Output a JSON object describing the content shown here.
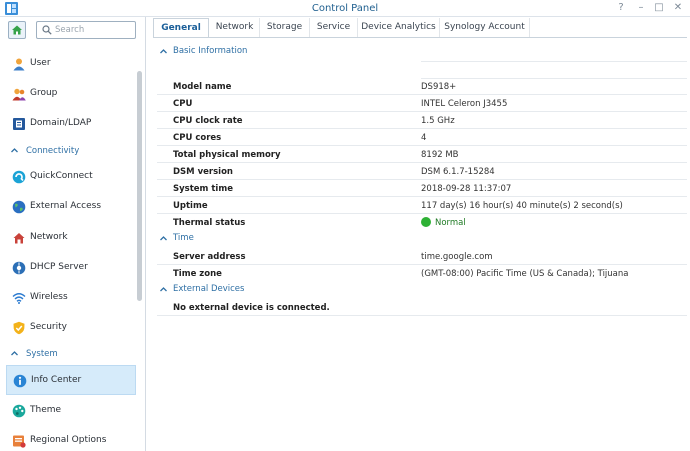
{
  "window": {
    "title": "Control Panel",
    "controls": [
      "help-icon",
      "minimize-icon",
      "maximize-icon",
      "close-icon"
    ]
  },
  "sidebar": {
    "search_placeholder": "Search",
    "items": [
      {
        "label": "User",
        "icon": "user-icon"
      },
      {
        "label": "Group",
        "icon": "group-icon"
      },
      {
        "label": "Domain/LDAP",
        "icon": "domain-icon"
      },
      {
        "label": "QuickConnect",
        "icon": "quickconnect-icon"
      },
      {
        "label": "External Access",
        "icon": "globe-icon"
      },
      {
        "label": "Network",
        "icon": "network-icon"
      },
      {
        "label": "DHCP Server",
        "icon": "dhcp-icon"
      },
      {
        "label": "Wireless",
        "icon": "wifi-icon"
      },
      {
        "label": "Security",
        "icon": "shield-icon"
      },
      {
        "label": "Info Center",
        "icon": "info-icon",
        "active": true
      },
      {
        "label": "Theme",
        "icon": "palette-icon"
      },
      {
        "label": "Regional Options",
        "icon": "regional-icon"
      }
    ],
    "sections": [
      "Connectivity",
      "System"
    ]
  },
  "tabs": [
    "General",
    "Network",
    "Storage",
    "Service",
    "Device Analytics",
    "Synology Account"
  ],
  "groups": {
    "basic": {
      "title": "Basic Information",
      "rows": [
        {
          "key": "Model name",
          "value": "DS918+"
        },
        {
          "key": "CPU",
          "value": "INTEL Celeron J3455"
        },
        {
          "key": "CPU clock rate",
          "value": "1.5 GHz"
        },
        {
          "key": "CPU cores",
          "value": "4"
        },
        {
          "key": "Total physical memory",
          "value": "8192 MB"
        },
        {
          "key": "DSM version",
          "value": "DSM 6.1.7-15284"
        },
        {
          "key": "System time",
          "value": "2018-09-28 11:37:07"
        },
        {
          "key": "Uptime",
          "value": "117 day(s) 16 hour(s) 40 minute(s) 2 second(s)"
        },
        {
          "key": "Thermal status",
          "value": "Normal"
        }
      ]
    },
    "time": {
      "title": "Time",
      "rows": [
        {
          "key": "Server address",
          "value": "time.google.com"
        },
        {
          "key": "Time zone",
          "value": "(GMT-08:00) Pacific Time (US & Canada); Tijuana"
        }
      ]
    },
    "external": {
      "title": "External Devices",
      "message": "No external device is connected."
    }
  },
  "colors": {
    "accent": "#2e6fa4",
    "active_bg": "#d6ebfa",
    "status_ok": "#2eb135"
  }
}
